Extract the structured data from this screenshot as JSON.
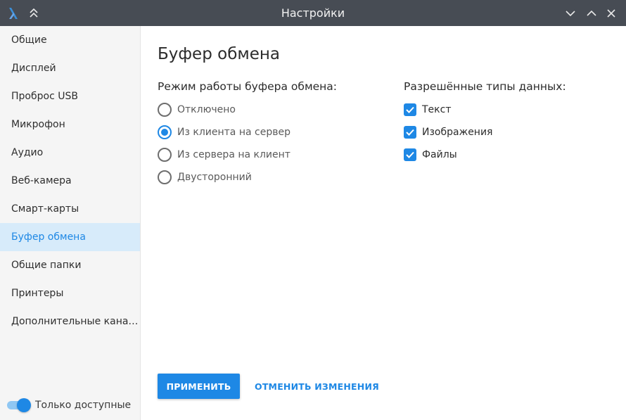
{
  "window": {
    "title": "Настройки",
    "icons": {
      "app_logo": "app-logo-icon",
      "collapse": "double-chevron-up-icon",
      "minimize": "chevron-down-icon",
      "maximize": "chevron-up-icon",
      "close": "close-icon"
    }
  },
  "sidebar": {
    "items": [
      {
        "label": "Общие",
        "active": false
      },
      {
        "label": "Дисплей",
        "active": false
      },
      {
        "label": "Проброс USB",
        "active": false
      },
      {
        "label": "Микрофон",
        "active": false
      },
      {
        "label": "Аудио",
        "active": false
      },
      {
        "label": "Веб-камера",
        "active": false
      },
      {
        "label": "Смарт-карты",
        "active": false
      },
      {
        "label": "Буфер обмена",
        "active": true
      },
      {
        "label": "Общие папки",
        "active": false
      },
      {
        "label": "Принтеры",
        "active": false
      },
      {
        "label": "Дополнительные кана…",
        "active": false
      }
    ],
    "toggle": {
      "label": "Только доступные",
      "on": true
    }
  },
  "main": {
    "title": "Буфер обмена",
    "mode": {
      "label": "Режим работы буфера обмена:",
      "options": [
        {
          "label": "Отключено",
          "selected": false
        },
        {
          "label": "Из клиента на сервер",
          "selected": true
        },
        {
          "label": "Из сервера на клиент",
          "selected": false
        },
        {
          "label": "Двусторонний",
          "selected": false
        }
      ]
    },
    "data_types": {
      "label": "Разрешённые типы данных:",
      "options": [
        {
          "label": "Текст",
          "checked": true
        },
        {
          "label": "Изображения",
          "checked": true
        },
        {
          "label": "Файлы",
          "checked": true
        }
      ]
    },
    "buttons": {
      "apply": "ПРИМЕНИТЬ",
      "cancel": "ОТМЕНИТЬ ИЗМЕНЕНИЯ"
    }
  },
  "colors": {
    "accent": "#1e88e5",
    "titlebar": "#474c54",
    "sidebar_bg": "#f5f5f5",
    "active_item_bg": "#d7ebfa"
  }
}
